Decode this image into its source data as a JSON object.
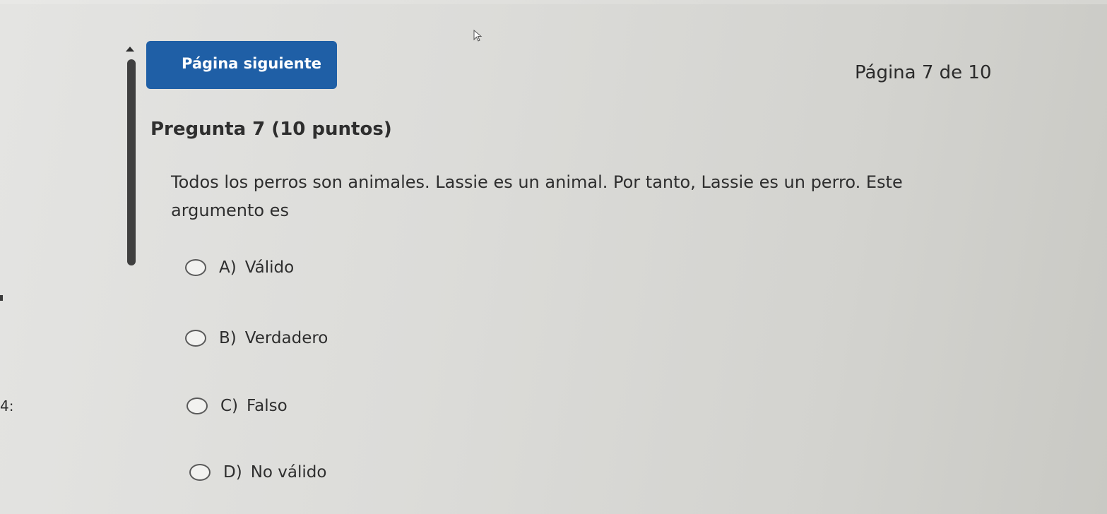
{
  "navigation": {
    "next_button_label": "Página siguiente",
    "page_indicator": "Página 7 de 10"
  },
  "question": {
    "title": "Pregunta 7 (10 puntos)",
    "text": "Todos los perros son animales. Lassie es un animal. Por tanto, Lassie es un perro. Este argumento es",
    "options": [
      {
        "letter": "A)",
        "label": "Válido"
      },
      {
        "letter": "B)",
        "label": "Verdadero"
      },
      {
        "letter": "C)",
        "label": "Falso"
      },
      {
        "letter": "D)",
        "label": "No válido"
      }
    ]
  },
  "side_panel": {
    "partial_label": "4:"
  },
  "colors": {
    "accent": "#1f5fa6",
    "background": "#dcdcd9"
  },
  "icons": {
    "cursor": "mouse-pointer-icon",
    "scroll_up": "scroll-up-arrow-icon",
    "radio": "radio-unchecked-icon"
  }
}
